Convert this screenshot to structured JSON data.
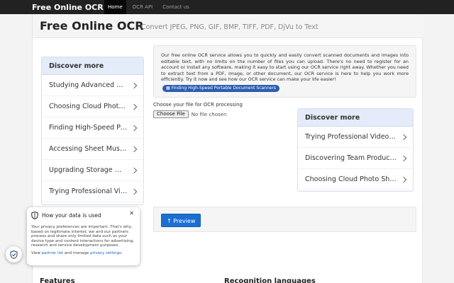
{
  "navbar": {
    "brand": "Free Online OCR",
    "links": [
      {
        "label": "Home",
        "active": true
      },
      {
        "label": "OCR API",
        "active": false
      },
      {
        "label": "Contact us",
        "active": false
      }
    ]
  },
  "header": {
    "title": "Free Online OCR",
    "subtitle": "Convert JPEG, PNG, GIF, BMP, TIFF, PDF, DjVu to Text"
  },
  "discover_left": {
    "heading": "Discover more",
    "items": [
      "Studying Advanced Computer Science",
      "Choosing Cloud Photo Storage",
      "Finding High-Speed Portable Document Scanners",
      "Accessing Sheet Music Online",
      "Upgrading Storage With Cloud Services",
      "Trying Professional Video Editing Software"
    ]
  },
  "description": "Our free online OCR service allows you to quickly and easily convert scanned documents and images into editable text, with no limits on the number of files you can upload. There's no need to register for an account or install any software, making it easy to start using our OCR service right away. Whether you need to extract text from a PDF, image, or other document, our OCR service is here to help you work more efficiently. Try it now and see how our OCR service can make your life easier!",
  "promo_chip": "Finding High-Speed Portable Document Scanners",
  "upload": {
    "label": "Choose your file for OCR processing",
    "button": "Choose File",
    "status": "No file chosen"
  },
  "discover_right": {
    "heading": "Discover more",
    "items": [
      "Trying Professional Video Editing Software",
      "Discovering Team Productivity Tools",
      "Choosing Cloud Photo Sharing Services"
    ]
  },
  "preview_button": "Preview",
  "sections": {
    "features": "Features",
    "languages": "Recognition languages"
  },
  "privacy": {
    "title": "How your data is used",
    "body": "Your privacy preferences are important. That's why, based on legitimate interest, we and our partners process and share only limited data such as your device type and content interactions for advertising, research and service development purposes.",
    "foot_prefix": "View ",
    "partner_link": "partner list",
    "foot_mid": " and manage ",
    "settings_link": "privacy settings",
    "foot_suffix": "."
  },
  "colors": {
    "navbar": "#222222",
    "accent": "#1a6fd1",
    "discover_head": "#e3ecf8"
  }
}
